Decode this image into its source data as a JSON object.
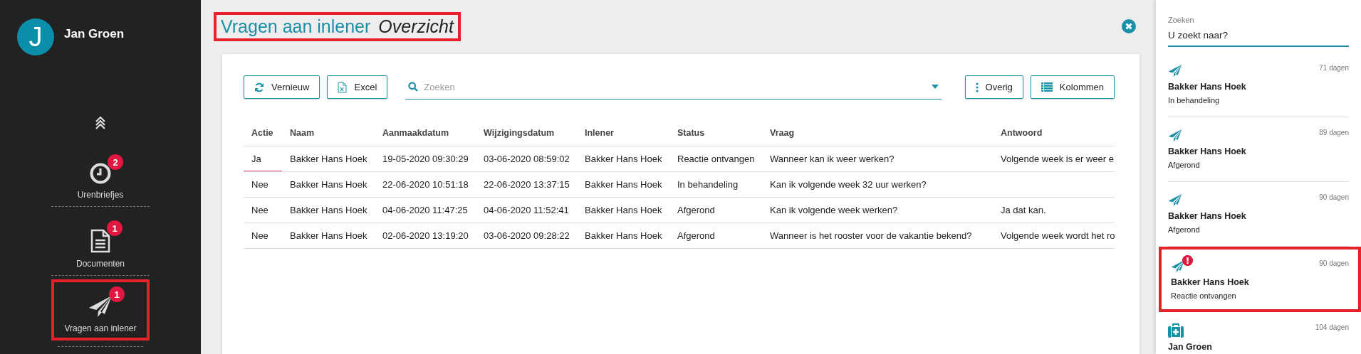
{
  "user": {
    "initial": "J",
    "name": "Jan Groen"
  },
  "nav": [
    {
      "kind": "clock",
      "label": "Urenbriefjes",
      "badge": "2",
      "highlighted": false
    },
    {
      "kind": "document",
      "label": "Documenten",
      "badge": "1",
      "highlighted": false
    },
    {
      "kind": "send",
      "label": "Vragen aan inlener",
      "badge": "1",
      "highlighted": true
    }
  ],
  "page_title": {
    "title": "Vragen aan inlener",
    "subtitle": "Overzicht",
    "highlighted": true
  },
  "toolbar": {
    "buttons": [
      {
        "kind": "refresh",
        "label": "Vernieuw"
      },
      {
        "kind": "excel",
        "label": "Excel"
      }
    ],
    "search": {
      "placeholder": "Zoeken"
    },
    "right_buttons": [
      {
        "kind": "more",
        "label": "Overig"
      },
      {
        "kind": "columns",
        "label": "Kolommen"
      }
    ]
  },
  "table": {
    "columns": [
      "Actie",
      "Naam",
      "Aanmaakdatum",
      "Wijzigingsdatum",
      "Inlener",
      "Status",
      "Vraag",
      "Antwoord"
    ],
    "rows": [
      {
        "focused": true,
        "cells": [
          "Ja",
          "Bakker Hans Hoek",
          "19-05-2020 09:30:29",
          "03-06-2020 08:59:02",
          "Bakker Hans Hoek",
          "Reactie ontvangen",
          "Wanneer kan ik weer werken?",
          "Volgende week is er weer e"
        ]
      },
      {
        "focused": false,
        "cells": [
          "Nee",
          "Bakker Hans Hoek",
          "22-06-2020 10:51:18",
          "22-06-2020 13:37:15",
          "Bakker Hans Hoek",
          "In behandeling",
          "Kan ik volgende week 32 uur werken?",
          ""
        ]
      },
      {
        "focused": false,
        "cells": [
          "Nee",
          "Bakker Hans Hoek",
          "04-06-2020 11:47:25",
          "04-06-2020 11:52:41",
          "Bakker Hans Hoek",
          "Afgerond",
          "Kan ik volgende week werken?",
          "Ja dat kan."
        ]
      },
      {
        "focused": false,
        "cells": [
          "Nee",
          "Bakker Hans Hoek",
          "02-06-2020 13:19:20",
          "03-06-2020 09:28:22",
          "Bakker Hans Hoek",
          "Afgerond",
          "Wanneer is het rooster voor de vakantie bekend?",
          "Volgende week wordt het ro"
        ]
      }
    ]
  },
  "side_search": {
    "label": "Zoeken",
    "placeholder": "U zoekt naar?"
  },
  "side_items": [
    {
      "kind": "send",
      "age": "71 dagen",
      "name": "Bakker Hans Hoek",
      "status": "In behandeling",
      "alert": false,
      "highlighted": false
    },
    {
      "kind": "send",
      "age": "89 dagen",
      "name": "Bakker Hans Hoek",
      "status": "Afgerond",
      "alert": false,
      "highlighted": false
    },
    {
      "kind": "send",
      "age": "90 dagen",
      "name": "Bakker Hans Hoek",
      "status": "Afgerond",
      "alert": false,
      "highlighted": false
    },
    {
      "kind": "send",
      "age": "90 dagen",
      "name": "Bakker Hans Hoek",
      "status": "Reactie ontvangen",
      "alert": true,
      "highlighted": true
    },
    {
      "kind": "medical",
      "age": "104 dagen",
      "name": "Jan Groen",
      "alert": false,
      "highlighted": false
    }
  ]
}
